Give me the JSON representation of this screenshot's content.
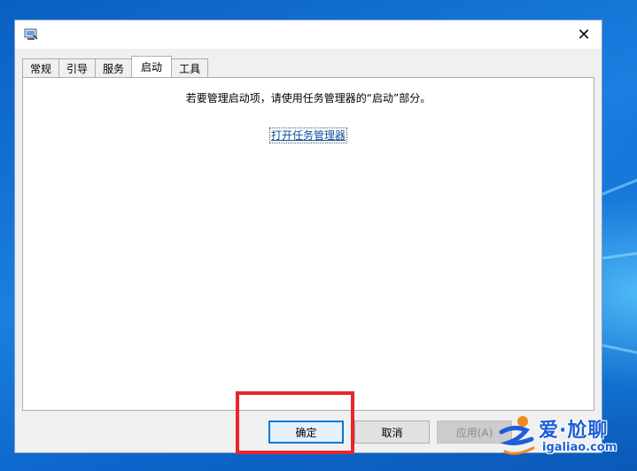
{
  "dialog": {
    "close_glyph": "✕",
    "tabs": [
      {
        "label": "常规",
        "active": false
      },
      {
        "label": "引导",
        "active": false
      },
      {
        "label": "服务",
        "active": false
      },
      {
        "label": "启动",
        "active": true
      },
      {
        "label": "工具",
        "active": false
      }
    ],
    "startup": {
      "message": "若要管理启动项，请使用任务管理器的“启动”部分。",
      "link": "打开任务管理器"
    },
    "buttons": {
      "ok": "确定",
      "cancel": "取消",
      "apply": "应用(A)"
    }
  },
  "annotation": {
    "color": "#e8262b"
  },
  "watermark": {
    "name": "爱·尬聊",
    "url": "igaliao.com"
  },
  "colors": {
    "accent": "#0078d7",
    "link": "#0b4e96"
  }
}
